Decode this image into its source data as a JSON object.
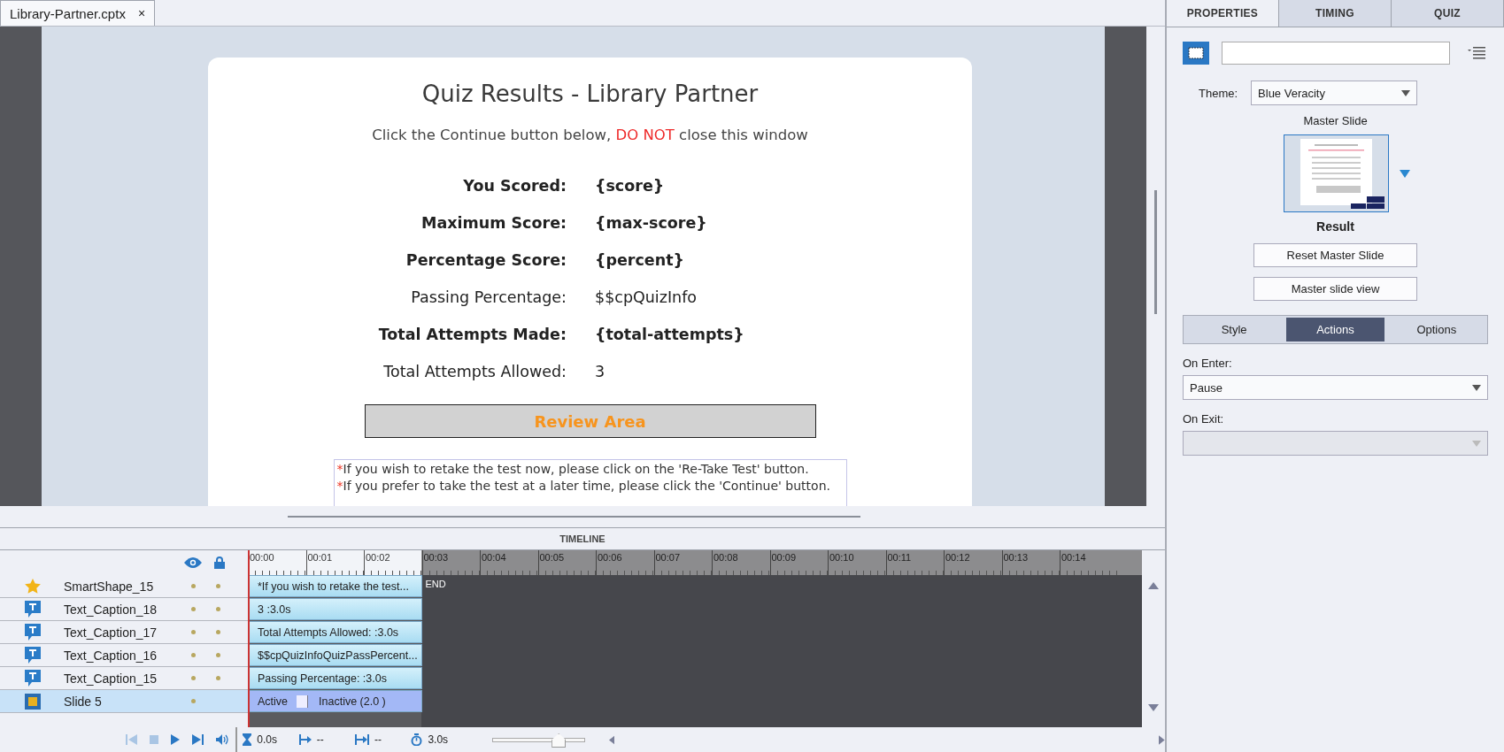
{
  "document_tab": {
    "title": "Library-Partner.cptx",
    "close": "×"
  },
  "slide": {
    "title": "Quiz Results - Library Partner",
    "subtitle": {
      "before": "Click the Continue button below, ",
      "emphasis": "DO NOT",
      "after": " close this window"
    },
    "score_rows": [
      {
        "label": "You Scored:",
        "value": "{score}",
        "bold": true
      },
      {
        "label": "Maximum Score:",
        "value": "{max-score}",
        "bold": true
      },
      {
        "label": "Percentage Score:",
        "value": "{percent}",
        "bold": true
      },
      {
        "label": "Passing Percentage:",
        "value": "$$cpQuizInfo",
        "bold": false
      },
      {
        "label": "Total Attempts Made:",
        "value": "{total-attempts}",
        "bold": true
      },
      {
        "label": "Total Attempts Allowed:",
        "value": "3",
        "bold": false
      }
    ],
    "review_button": "Review Area",
    "notes": [
      {
        "marker": "*",
        "text": "If you wish to retake the test now, please click on the 'Re-Take Test' button."
      },
      {
        "marker": "*",
        "text": "If you prefer to take the test at a later time, please click the 'Continue' button."
      }
    ]
  },
  "timeline": {
    "title": "TIMELINE",
    "ruler": [
      "00:00",
      "00:01",
      "00:02",
      "00:03",
      "00:04",
      "00:05",
      "00:06",
      "00:07",
      "00:08",
      "00:09",
      "00:10",
      "00:11",
      "00:12",
      "00:13",
      "00:14"
    ],
    "end_label": "END",
    "layers": [
      {
        "kind": "star",
        "name": "SmartShape_15",
        "selected": false,
        "lock_dot": true,
        "bar": "*If you wish to retake the test..."
      },
      {
        "kind": "caption",
        "name": "Text_Caption_18",
        "selected": false,
        "lock_dot": true,
        "bar": "3 :3.0s"
      },
      {
        "kind": "caption",
        "name": "Text_Caption_17",
        "selected": false,
        "lock_dot": true,
        "bar": "Total Attempts Allowed: :3.0s"
      },
      {
        "kind": "caption",
        "name": "Text_Caption_16",
        "selected": false,
        "lock_dot": true,
        "bar": "$$cpQuizInfoQuizPassPercent..."
      },
      {
        "kind": "caption",
        "name": "Text_Caption_15",
        "selected": false,
        "lock_dot": true,
        "bar": "Passing Percentage: :3.0s"
      },
      {
        "kind": "slide",
        "name": "Slide 5",
        "selected": true,
        "lock_dot": false,
        "bar": "Active",
        "bar_inactive": "Inactive (2.0 )"
      }
    ],
    "playback": [
      {
        "kind": "first",
        "disabled": true
      },
      {
        "kind": "stop",
        "disabled": true
      },
      {
        "kind": "play",
        "disabled": false
      },
      {
        "kind": "last",
        "disabled": false
      },
      {
        "kind": "volume",
        "disabled": false
      }
    ],
    "controls": {
      "start_time": "0.0s",
      "fade_in": "--",
      "fade_out": "--",
      "duration": "3.0s",
      "zoom": {
        "level": 0.68
      }
    }
  },
  "properties": {
    "tabs": [
      {
        "label": "PROPERTIES",
        "selected": true
      },
      {
        "label": "TIMING",
        "selected": false
      },
      {
        "label": "QUIZ",
        "selected": false
      }
    ],
    "theme_label": "Theme:",
    "theme": "Blue Veracity",
    "master_slide_label": "Master Slide",
    "master_slide_name": "Result",
    "buttons": [
      "Reset Master Slide",
      "Master slide view"
    ],
    "subtabs": [
      {
        "label": "Style",
        "selected": false
      },
      {
        "label": "Actions",
        "selected": true
      },
      {
        "label": "Options",
        "selected": false
      }
    ],
    "on_enter": {
      "label": "On Enter:",
      "value": "Pause",
      "disabled": false
    },
    "on_exit": {
      "label": "On Exit:",
      "disabled": true
    }
  }
}
